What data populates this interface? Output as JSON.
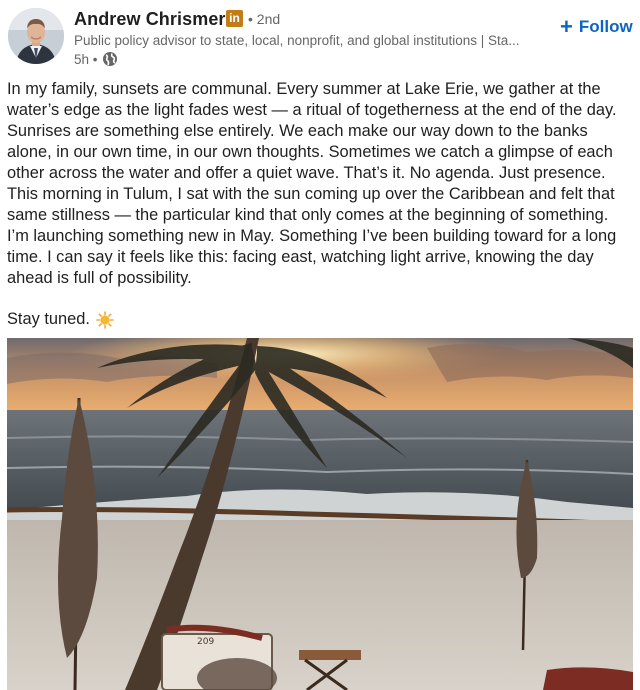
{
  "post": {
    "author": {
      "name": "Andrew Chrismer",
      "badge": "in",
      "degree": "• 2nd",
      "headline": "Public policy advisor to state, local, nonprofit, and global institutions | Sta...",
      "time": "5h •",
      "visibility_icon": "globe-icon"
    },
    "follow_label": "Follow",
    "body": "In my family, sunsets are communal. Every summer at Lake Erie, we gather at the\nwater’s edge as the light fades west — a ritual of togetherness at the end of the day.\nSunrises are something else entirely. We each make our way down to the banks\nalone, in our own time, in our own thoughts. Sometimes we catch a glimpse of each\nother across the water and offer a quiet wave. That’s it. No agenda. Just presence.\nThis morning in Tulum, I sat with the sun coming up over the Caribbean and felt that\nsame stillness — the particular kind that only comes at the beginning of something.\nI’m launching something new in May. Something I’ve been building toward for a long\ntime. I can say it feels like this: facing east, watching light arrive, knowing the day\nahead is full of possibility.",
    "closing": "Stay tuned.",
    "closing_icon": "sun-emoji-icon",
    "photo_label": "209"
  },
  "colors": {
    "accent": "#0a66c2",
    "premium_badge": "#c37d16",
    "muted_text": "#666666"
  }
}
